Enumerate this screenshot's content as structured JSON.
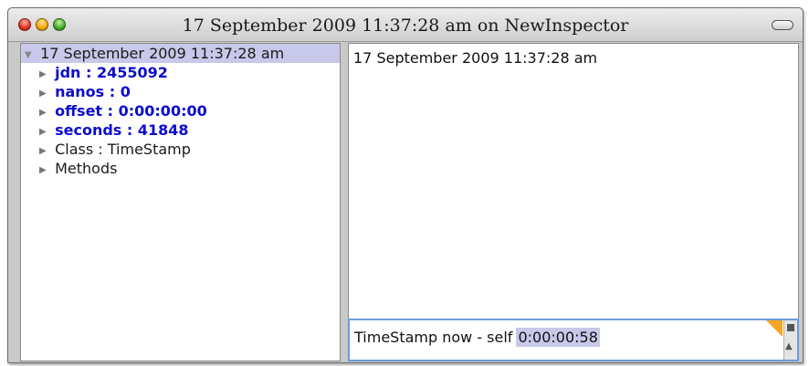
{
  "window": {
    "title": "17 September 2009 11:37:28 am on NewInspector"
  },
  "tree": {
    "root": "17 September 2009 11:37:28 am",
    "children": [
      {
        "label": "jdn : 2455092",
        "bold": true
      },
      {
        "label": "nanos : 0",
        "bold": true
      },
      {
        "label": "offset : 0:00:00:00",
        "bold": true
      },
      {
        "label": "seconds : 41848",
        "bold": true
      },
      {
        "label": "Class : TimeStamp",
        "bold": false
      },
      {
        "label": "Methods",
        "bold": false
      }
    ]
  },
  "detail": {
    "text": "17 September 2009 11:37:28 am"
  },
  "evaluator": {
    "code": "TimeStamp now - self",
    "result": "0:00:00:58"
  },
  "icons": {
    "expanded": "triangle-down-icon",
    "collapsed": "triangle-right-icon"
  },
  "colors": {
    "selection": "#c8c8ea",
    "bold_field": "#0c0ccf",
    "eval_border": "#6f9bd6",
    "corner_accent": "#f5a623"
  }
}
